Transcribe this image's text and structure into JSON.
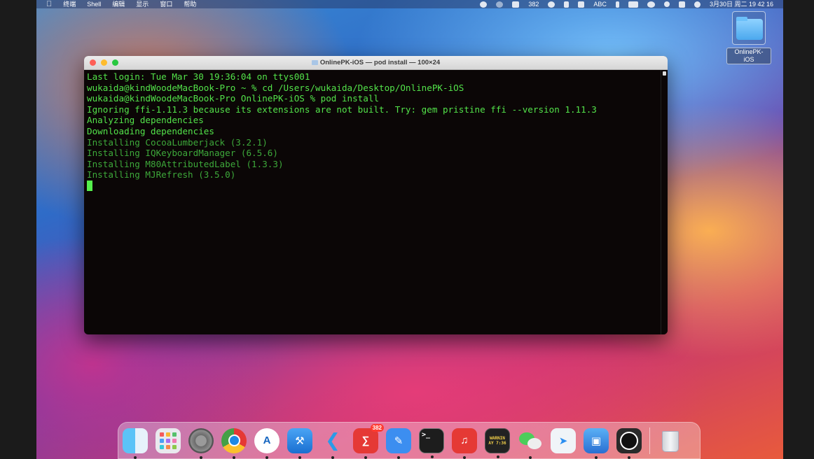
{
  "menubar": {
    "apple": "",
    "items": [
      "终端",
      "Shell",
      "编辑",
      "显示",
      "窗口",
      "帮助"
    ],
    "status": {
      "badge_count": "382",
      "input_source": "ABC",
      "datetime": "3月30日 周二 19 42 16"
    }
  },
  "desktop": {
    "folder_label": "OnlinePK-iOS"
  },
  "terminal": {
    "title": "OnlinePK-iOS — pod install — 100×24",
    "lines": [
      "Last login: Tue Mar 30 19:36:04 on ttys001",
      "wukaida@kindWoodeMacBook-Pro ~ % cd /Users/wukaida/Desktop/OnlinePK-iOS",
      "wukaida@kindWoodeMacBook-Pro OnlinePK-iOS % pod install",
      "Ignoring ffi-1.11.3 because its extensions are not built. Try: gem pristine ffi --version 1.11.3",
      "Analyzing dependencies",
      "Downloading dependencies",
      "Installing CocoaLumberjack (3.2.1)",
      "Installing IQKeyboardManager (6.5.6)",
      "Installing M80AttributedLabel (1.3.3)",
      "Installing MJRefresh (3.5.0)"
    ]
  },
  "dock": {
    "weibo_badge": "382",
    "terminal_glyph": ">_",
    "console_text": "WARNIN\nAY 7:36",
    "apps": [
      "finder-icon",
      "launchpad-icon",
      "system-preferences-icon",
      "chrome-icon",
      "instruments-icon",
      "xcode-icon",
      "vscode-icon",
      "weibo-icon",
      "pen-icon",
      "terminal-icon",
      "netease-music-icon",
      "console-icon",
      "wechat-icon",
      "testflight-icon",
      "simulator-icon",
      "obs-icon",
      "trash-icon"
    ]
  },
  "colors": {
    "terminal_text": "#53e34a",
    "terminal_bg": "#0b0606",
    "cursor": "#55f04c"
  }
}
